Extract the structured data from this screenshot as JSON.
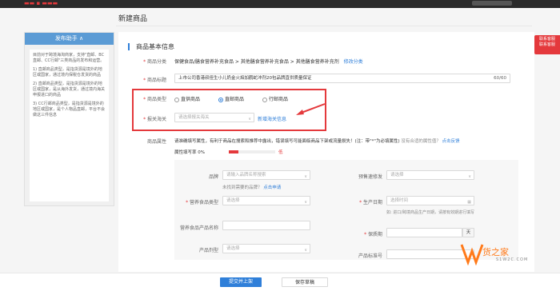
{
  "topbar": {
    "brand": "▬▬ ▪ ▬▬▬"
  },
  "page_title": "新建商品",
  "sidebar": {
    "header": "发布助手 ∧",
    "paragraphs": [
      "目前对于跨境海淘商家，支持\"直邮、BC直邮、CC行邮\"三类商品的发布和运营。",
      "1) 直邮商品类型，是指货源是境外的地区或国家，通过境内保税仓发货的商品",
      "2) 直邮商品类型，是指货源是境外的地区或国家，是从海外发货，通过境内海关申报进口的商品",
      "3) CC行邮商品类型，是指货源是境外的地区或国家，是个人物品直邮，平台不会做这三件信息"
    ]
  },
  "section_title": "商品基本信息",
  "category": {
    "label": "商品分类",
    "value": "保健食品/膳食营养补充食品 > 其他膳食营养补充食品 > 其他膳食营养补充剂",
    "edit_link": "修改分类"
  },
  "product_title": {
    "label": "商品标题",
    "value": "上市公司香港叔侄生小儿奶金火焰加鹳蛇冲剂20包品牌直供质量保证",
    "counter": "60/60"
  },
  "product_type": {
    "label": "商品类型",
    "options": [
      "直供商品",
      "直邮商品",
      "行邮商品"
    ],
    "selected_index": 1
  },
  "customs": {
    "label": "报关海关",
    "placeholder": "请选择报关海关",
    "add_link": "新增海关信息"
  },
  "attributes": {
    "label": "商品属性",
    "notice": "请准确填写属性，有利于商品在搜索和推荐中露出，错误填写可能面临商品下架或流量损失！(注：带\"*\"为必填属性)",
    "notice_extra": "没有合适的属性值？",
    "feedback_link": "点击反馈",
    "fill_rate_label": "属性填写率 0%",
    "fill_rate_low": "低",
    "fill_rate": 0.2,
    "fields": {
      "brand_label": "品牌",
      "brand_placeholder": "请输入品牌名称搜索",
      "brand_hint": "未找到需要的品牌？",
      "brand_link": "点击申请",
      "presale_label": "预售速修发",
      "presale_placeholder": "请选择",
      "nutrition_type_label": "营养食品类型",
      "nutrition_type_placeholder": "请选择",
      "prod_date_label": "生产日期",
      "prod_date_placeholder": "选择时间",
      "prod_date_note": "如: 进口/跨境商品生产日期，请按有效期进行填写",
      "nutrition_name_label": "营养食品产品名称",
      "shelf_life_label": "保质期",
      "shelf_life_unit": "天",
      "form_label": "产品剂型",
      "form_placeholder": "请选择",
      "standard_label": "产品标准号"
    }
  },
  "footer": {
    "submit": "提交并上架",
    "save_draft": "保存草稿"
  },
  "side_badge": "联系客服\n联系客服",
  "watermark": {
    "text": "货之家",
    "sub": "S1W2C.COM"
  }
}
